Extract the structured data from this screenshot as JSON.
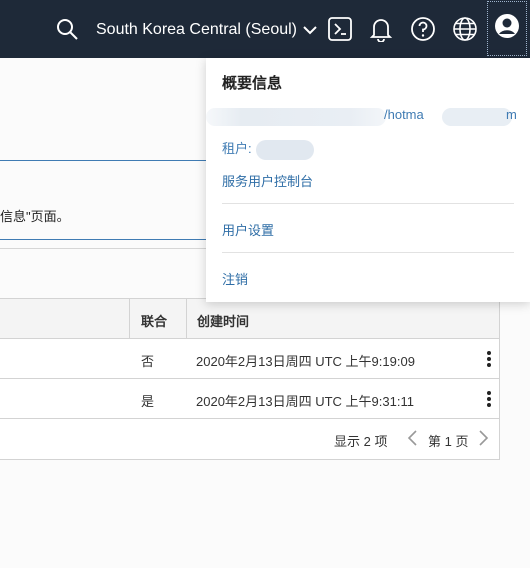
{
  "header": {
    "region_label": "South Korea Central (Seoul)",
    "icons": [
      "search-icon",
      "cloud-shell-icon",
      "bell-icon",
      "help-icon",
      "globe-icon",
      "user-icon"
    ],
    "colors": {
      "bar": "#1e2938",
      "icon": "#ffffff"
    }
  },
  "page": {
    "info_text": "信息\"页面。"
  },
  "table": {
    "columns": [
      "联合",
      "创建时间"
    ],
    "rows": [
      {
        "federated": "否",
        "created": "2020年2月13日周四 UTC 上午9:19:09"
      },
      {
        "federated": "是",
        "created": "2020年2月13日周四 UTC 上午9:31:11"
      }
    ],
    "footer": {
      "count_label": "显示 2 项",
      "page_label": "第 1 页"
    }
  },
  "profile_menu": {
    "title": "概要信息",
    "email_partial": "/hotma",
    "email_end": "m",
    "tenant_label": "租户: ",
    "service_console_link": "服务用户控制台",
    "user_settings_link": "用户设置",
    "sign_out_link": "注销",
    "link_color": "#2e6da6"
  }
}
